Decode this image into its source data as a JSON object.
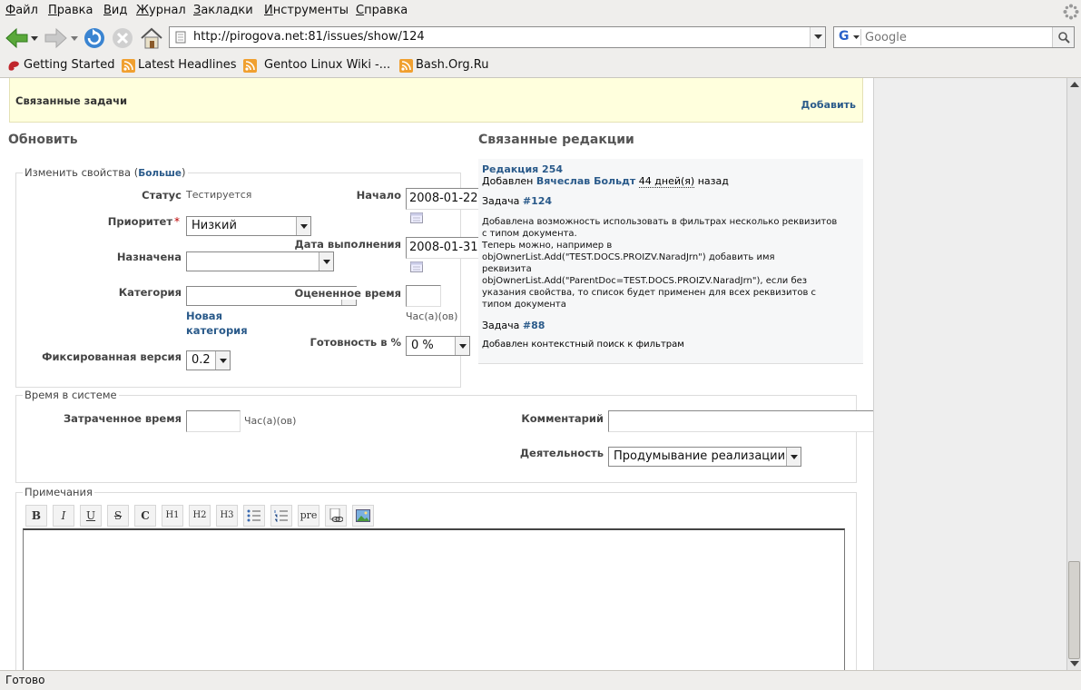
{
  "menu": [
    "Файл",
    "Правка",
    "Вид",
    "Журнал",
    "Закладки",
    "Инструменты",
    "Справка"
  ],
  "url": "http://pirogova.net:81/issues/show/124",
  "search": {
    "engine": "G",
    "placeholder": "Google"
  },
  "bookmarks": [
    "Getting Started",
    "Latest Headlines",
    "Gentoo Linux Wiki -...",
    "Bash.Org.Ru"
  ],
  "related": {
    "title": "Связанные задачи",
    "add": "Добавить"
  },
  "update": {
    "title": "Обновить",
    "props_legend": "Изменить свойства (",
    "props_more": "Больше",
    "props_close": ")",
    "status_label": "Статус",
    "status_value": "Тестируется",
    "priority_label": "Приоритет",
    "required_mark": "*",
    "priority_value": "Низкий",
    "assigned_label": "Назначена",
    "assigned_value": "",
    "category_label": "Категория",
    "category_value": "",
    "new_category_1": "Новая",
    "new_category_2": "категория",
    "version_label": "Фиксированная версия",
    "version_value": "0.2",
    "start_label": "Начало",
    "start_value": "2008-01-22",
    "due_label": "Дата выполнения",
    "due_value": "2008-01-31",
    "estimate_label": "Оцененное время",
    "estimate_value": "",
    "estimate_unit": "Час(а)(ов)",
    "done_label": "Готовность в %",
    "done_value": "0 %"
  },
  "time": {
    "legend": "Время в системе",
    "spent_label": "Затраченное время",
    "spent_value": "",
    "spent_unit": "Час(а)(ов)",
    "comment_label": "Комментарий",
    "comment_value": "",
    "activity_label": "Деятельность",
    "activity_value": "Продумывание реализации"
  },
  "notes": {
    "legend": "Примечания",
    "toolbar": [
      "B",
      "I",
      "U",
      "S",
      "C",
      "H1",
      "H2",
      "H3",
      "ul",
      "ol",
      "pre",
      "link",
      "img"
    ]
  },
  "revisions": {
    "title": "Связанные редакции",
    "items": [
      {
        "name": "Редакция 254",
        "added": "Добавлен",
        "author": "Вячеслав Больдт",
        "ago": "44 дней(я)",
        "ago_suffix": "назад",
        "task_label": "Задача",
        "task_ref": "#124",
        "lines": [
          "Добавлена возможность использовать в фильтрах несколько реквизитов",
          "с типом документа.",
          "Теперь можно, например в",
          "objOwnerList.Add(\"TEST.DOCS.PROIZV.NaradJrn\") добавить имя",
          "реквизита",
          "objOwnerList.Add(\"ParentDoc=TEST.DOCS.PROIZV.NaradJrn\"), если без",
          "указания свойства, то список будет применен для всех реквизитов с",
          "типом документа"
        ],
        "task2_label": "Задача",
        "task2_ref": "#88",
        "line2": "Добавлен контекстный поиск к фильтрам"
      }
    ]
  },
  "status": "Готово"
}
